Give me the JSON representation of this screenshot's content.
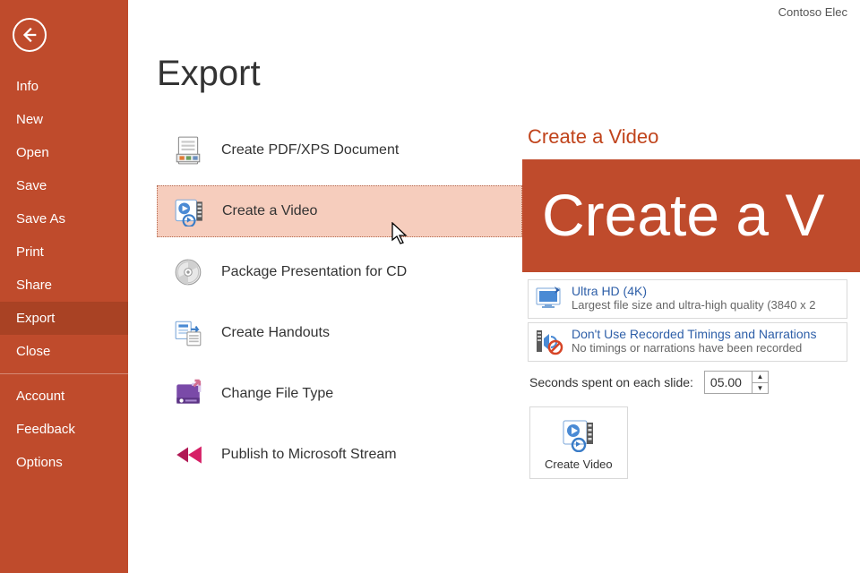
{
  "doc_title": "Contoso Elec",
  "sidebar": {
    "items": [
      "Info",
      "New",
      "Open",
      "Save",
      "Save As",
      "Print",
      "Share",
      "Export",
      "Close"
    ],
    "secondary": [
      "Account",
      "Feedback",
      "Options"
    ],
    "selected_index": 7
  },
  "export": {
    "heading": "Export",
    "options": [
      {
        "label": "Create PDF/XPS Document",
        "icon": "pdfxps"
      },
      {
        "label": "Create a Video",
        "icon": "video"
      },
      {
        "label": "Package Presentation for CD",
        "icon": "cd"
      },
      {
        "label": "Create Handouts",
        "icon": "handouts"
      },
      {
        "label": "Change File Type",
        "icon": "filetype"
      },
      {
        "label": "Publish to Microsoft Stream",
        "icon": "stream"
      }
    ],
    "selected_index": 1
  },
  "detail": {
    "heading": "Create a Video",
    "banner": "Create a V",
    "quality": {
      "title": "Ultra HD (4K)",
      "desc": "Largest file size and ultra-high quality (3840 x 2"
    },
    "timings": {
      "title": "Don't Use Recorded Timings and Narrations",
      "desc": "No timings or narrations have been recorded"
    },
    "seconds_label": "Seconds spent on each slide:",
    "seconds_value": "05.00",
    "action_button": "Create Video"
  }
}
